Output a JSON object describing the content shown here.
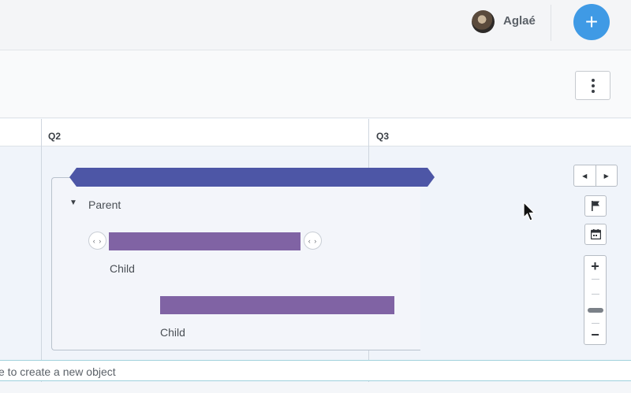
{
  "header": {
    "user_name": "Aglaé",
    "avatar_icon": "user-avatar",
    "add_button_icon": "plus-icon",
    "add_button_label": "+",
    "accent_color": "#3f9ae5"
  },
  "toolbar": {
    "more_icon": "vertical-ellipsis-icon"
  },
  "timeline": {
    "columns": [
      "Q2",
      "Q3"
    ],
    "summary_bar_color": "#4d56a6",
    "child_bar_color": "#8063a4",
    "group": {
      "label": "Parent",
      "caret": "▼"
    },
    "children": [
      {
        "label": "Child",
        "handle_left": "‹ ›",
        "handle_right": "‹ ›"
      },
      {
        "label": "Child"
      }
    ]
  },
  "controls": {
    "prev": "◀",
    "next": "▶",
    "flag_icon": "flag-icon",
    "calendar_icon": "calendar-icon",
    "zoom_in": "+",
    "zoom_out": "−"
  },
  "quick_add": {
    "hint": "e to create a new object"
  }
}
